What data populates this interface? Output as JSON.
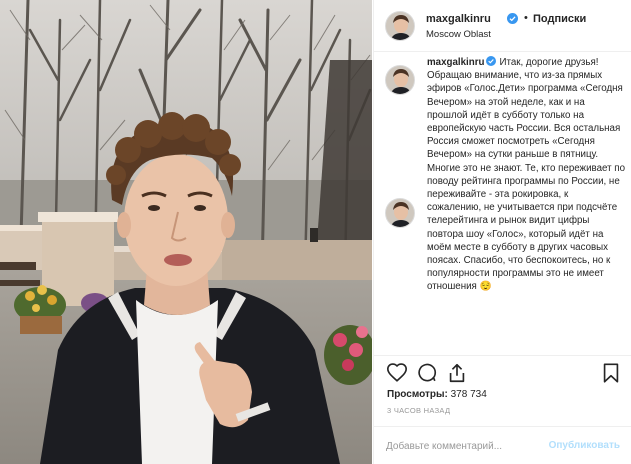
{
  "post": {
    "username": "maxgalkinru",
    "verified_icon": "verified-badge-icon",
    "separator": "•",
    "follow_label": "Подписки",
    "location": "Moscow Oblast"
  },
  "caption": {
    "username": "maxgalkinru",
    "text": "Итак, дорогие друзья! Обращаю внимание, что из-за прямых эфиров «Голос.Дети» программа «Сегодня Вечером» на этой неделе, как и на прошлой идёт в субботу только на европейскую часть России. Вся остальная Россия сможет посмотреть «Сегодня Вечером» на сутки раньше в пятницу. Многие это не знают. Те, кто переживает по поводу рейтинга программы по России, не переживайте - эта рокировка, к сожалению, не учитывается при подсчёте телерейтинга и рынок видит цифры повтора шоу «Голос», который идёт на моём месте в субботу в других часовых поясах. Спасибо, что беспокоитесь, но к популярности программы это не имеет отношения 😌"
  },
  "actions": {
    "icons": [
      "heart-icon",
      "comment-icon",
      "share-icon",
      "bookmark-icon"
    ],
    "views_label": "Просмотры:",
    "views_count": "378 734",
    "timestamp": "3 ЧАСОВ НАЗАД"
  },
  "comment_form": {
    "placeholder": "Добавьте комментарий...",
    "publish_label": "Опубликовать"
  },
  "colors": {
    "link_disabled": "#b2dffc",
    "verified": "#3897f0",
    "border": "#efefef"
  }
}
